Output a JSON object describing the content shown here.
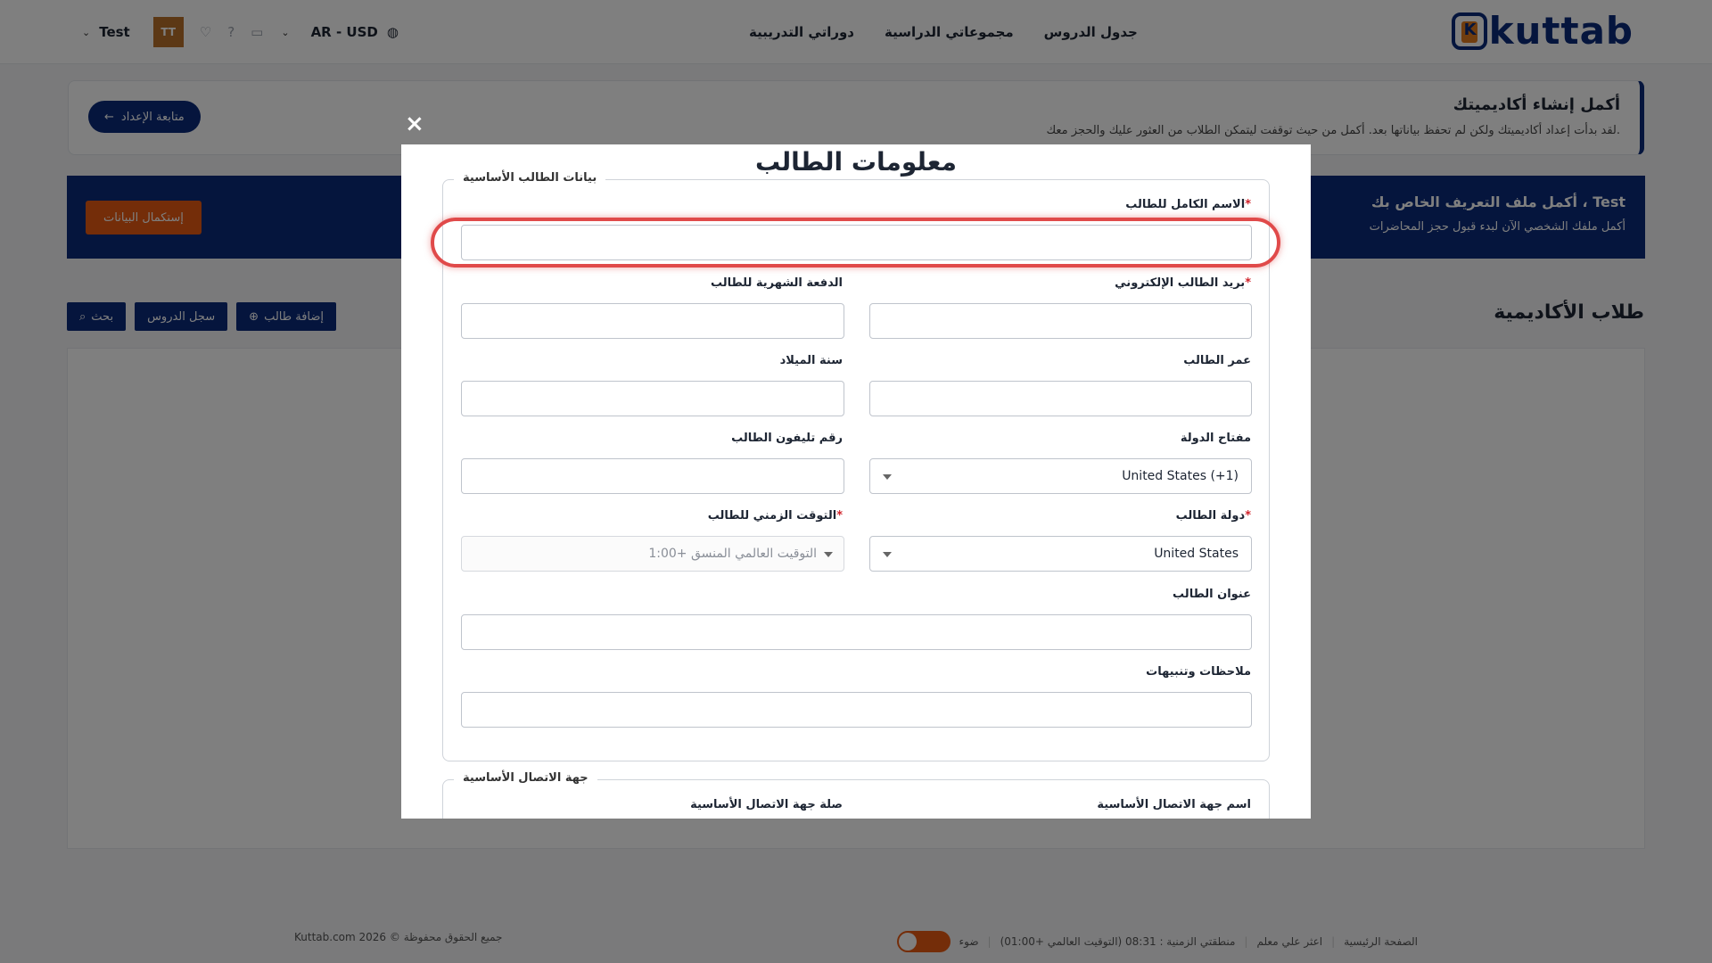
{
  "nav": {
    "logo_text": "kuttab",
    "links": [
      "جدول الدروس",
      "مجموعاتي الدراسية",
      "دوراتي التدريبية"
    ],
    "user_name": "Test",
    "avatar_initials": "TT",
    "currency": "AR - USD"
  },
  "setup": {
    "title": "أكمل إنشاء أكاديميتك",
    "description": "لقد بدأت إعداد أكاديميتك ولكن لم تحفظ بياناتها بعد. أكمل من حيث توقفت ليتمكن الطلاب من العثور عليك والحجز معك.",
    "button": "متابعة الإعداد"
  },
  "profile": {
    "title": "أكمل ملف التعريف الخاص بك ، Test",
    "description": "أكمل ملفك الشخصي الآن لبدء قبول حجز المحاضرات",
    "button": "إستكمال البيانات"
  },
  "students": {
    "title": "طلاب الأكاديمية",
    "add_button": "إضافة طالب",
    "log_button": "سجل الدروس",
    "search_button": "بحث"
  },
  "footer": {
    "copyright": "Kuttab.com 2026 © جميع الحقوق محفوظة",
    "home": "الصفحة الرئيسية",
    "find_teacher": "اعثر علي معلم",
    "timezone": "منطقتي الزمنية : 08:31 (التوقيت العالمي +01:00)",
    "light": "ضوء"
  },
  "modal": {
    "close": "×",
    "title": "معلومات الطالب",
    "section_basic": "بيانات الطالب الأساسية",
    "section_contact": "جهة الاتصال الأساسية",
    "fields": {
      "full_name": "الاسم الكامل للطالب",
      "email": "بريد الطالب الإلكتروني",
      "monthly_payment": "الدفعة الشهرية للطالب",
      "age": "عمر الطالب",
      "birth_year": "سنة الميلاد",
      "country_code": "مفتاح الدولة",
      "country_code_value": "United States (+1)",
      "phone": "رقم تليفون الطالب",
      "country": "دولة الطالب",
      "country_value": "United States",
      "timezone": "التوقت الزمني للطالب",
      "timezone_value": "التوقيت العالمي المنسق +1:00",
      "address": "عنوان الطالب",
      "notes": "ملاحظات وتنبيهات",
      "contact_name": "اسم جهة الاتصال الأساسية",
      "contact_relation": "صلة جهة الاتصال الأساسية"
    },
    "required_mark": "*"
  }
}
